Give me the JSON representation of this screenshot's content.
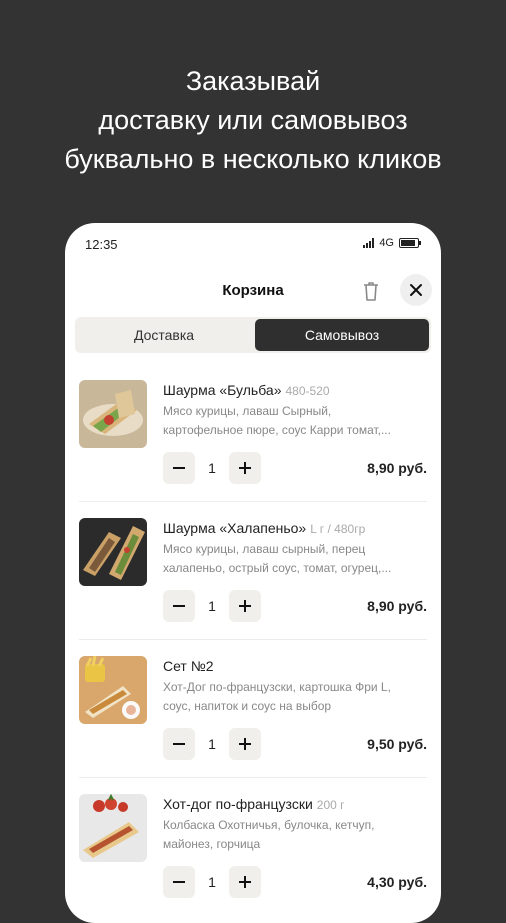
{
  "headline": [
    "Заказывай",
    "доставку или самовывоз",
    "буквально в несколько кликов"
  ],
  "status": {
    "time": "12:35",
    "network": "4G"
  },
  "header": {
    "title": "Корзина",
    "icons": [
      "trash-icon",
      "close-icon"
    ]
  },
  "tabs": [
    {
      "label": "Доставка",
      "active": false
    },
    {
      "label": "Самовывоз",
      "active": true
    }
  ],
  "items": [
    {
      "name": "Шаурма «Бульба»",
      "weight": "480-520",
      "desc": [
        "Мясо курицы, лаваш Сырный,",
        "картофельное пюре, соус Карри томат,..."
      ],
      "qty": "1",
      "price": "8,90 руб."
    },
    {
      "name": "Шаурма «Халапеньо»",
      "weight": "L г / 480гр",
      "desc": [
        "Мясо курицы, лаваш сырный, перец",
        "халапеньо, острый соус, томат, огурец,..."
      ],
      "qty": "1",
      "price": "8,90 руб."
    },
    {
      "name": "Сет №2",
      "weight": "",
      "desc": [
        "Хот-Дог по-французски, картошка Фри L,",
        "соус, напиток и соус на выбор"
      ],
      "qty": "1",
      "price": "9,50 руб."
    },
    {
      "name": "Хот-дог по-французски",
      "weight": "200 г",
      "desc": [
        "Колбаска Охотничья, булочка, кетчуп,",
        "майонез, горчица"
      ],
      "qty": "1",
      "price": "4,30 руб."
    }
  ],
  "colors": {
    "background": "#333333",
    "accent": "#2f2f2f",
    "chip": "#f1efeb"
  }
}
